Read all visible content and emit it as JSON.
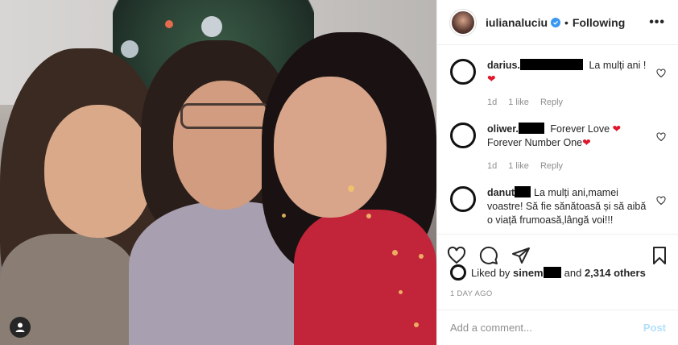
{
  "post": {
    "author": {
      "username": "iulianaluciu",
      "verified": true,
      "follow_status": "Following",
      "separator": "•"
    },
    "more_icon": "more-horizontal-icon",
    "photo_user_tag_icon": "user-tag-icon",
    "comments": [
      {
        "username_visible": "darius.",
        "redacted": true,
        "text": "La mulți ani !",
        "emoji": "heart",
        "time": "1d",
        "likes": "1 like",
        "reply_label": "Reply"
      },
      {
        "username_visible": "oliwer.",
        "redacted": true,
        "text_line1": "Forever Love",
        "text_line2": "Forever Number One",
        "emoji": "heart",
        "time": "1d",
        "likes": "1 like",
        "reply_label": "Reply"
      },
      {
        "username_visible": "danut",
        "redacted": true,
        "text": "La mulți ani,mamei voastre! Să fie sănătoasă și să aibă o viață frumoasă,lângă voi!!!"
      }
    ],
    "actions": {
      "like_icon": "heart-outline-icon",
      "comment_icon": "comment-icon",
      "share_icon": "share-icon",
      "save_icon": "bookmark-icon"
    },
    "likes": {
      "prefix": "Liked by",
      "user_visible": "sinem",
      "redacted": true,
      "suffix": "and",
      "others": "2,314 others"
    },
    "timestamp": "1 DAY AGO",
    "comment_input": {
      "placeholder": "Add a comment...",
      "post_label": "Post"
    },
    "colors": {
      "verified": "#3897f0",
      "heart": "#e0162b",
      "post_disabled": "#b2dffc",
      "muted": "#8e8e8e"
    }
  }
}
